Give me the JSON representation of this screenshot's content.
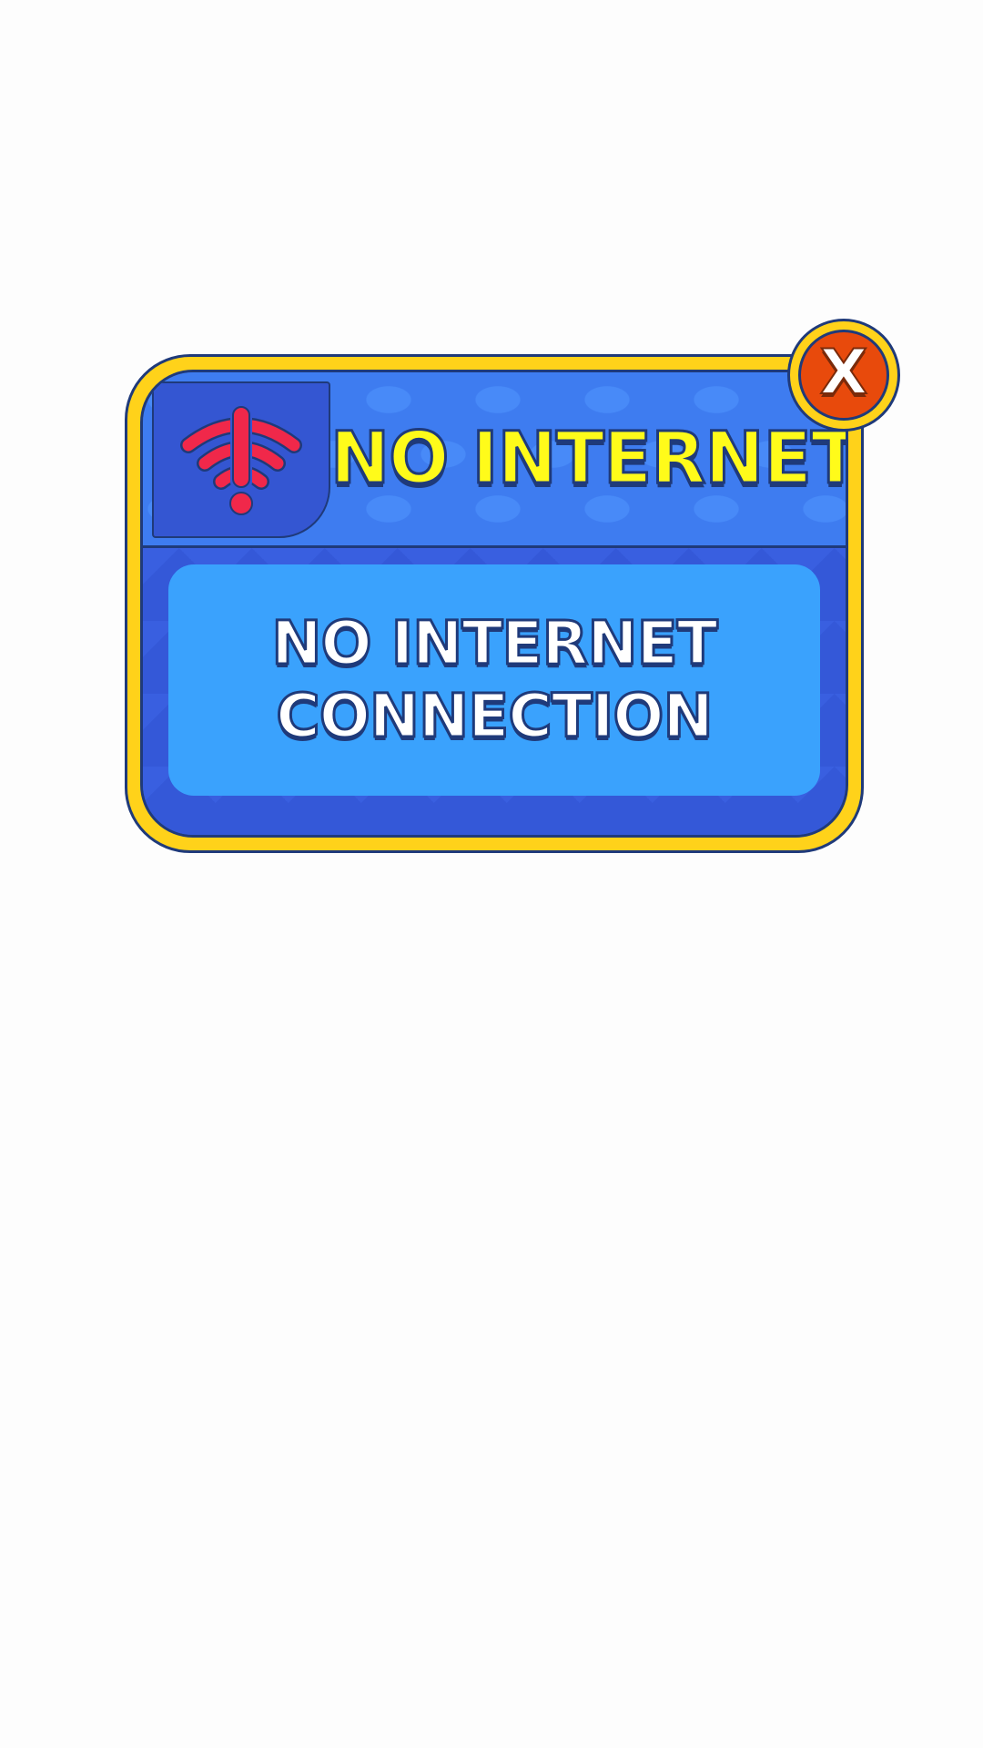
{
  "dialog": {
    "title": "NO INTERNET",
    "message_lines": [
      "NO INTERNET",
      "CONNECTION"
    ],
    "close_label": "X",
    "icon": "wifi-off-exclamation-icon"
  },
  "colors": {
    "frame": "#ffd21a",
    "panel": "#3458d8",
    "header": "#3e7cf0",
    "message_box": "#3aa2fd",
    "title_text": "#fffb1a",
    "icon": "#f0284a",
    "close_button": "#e84a0c",
    "outline": "#1f3a7a"
  }
}
